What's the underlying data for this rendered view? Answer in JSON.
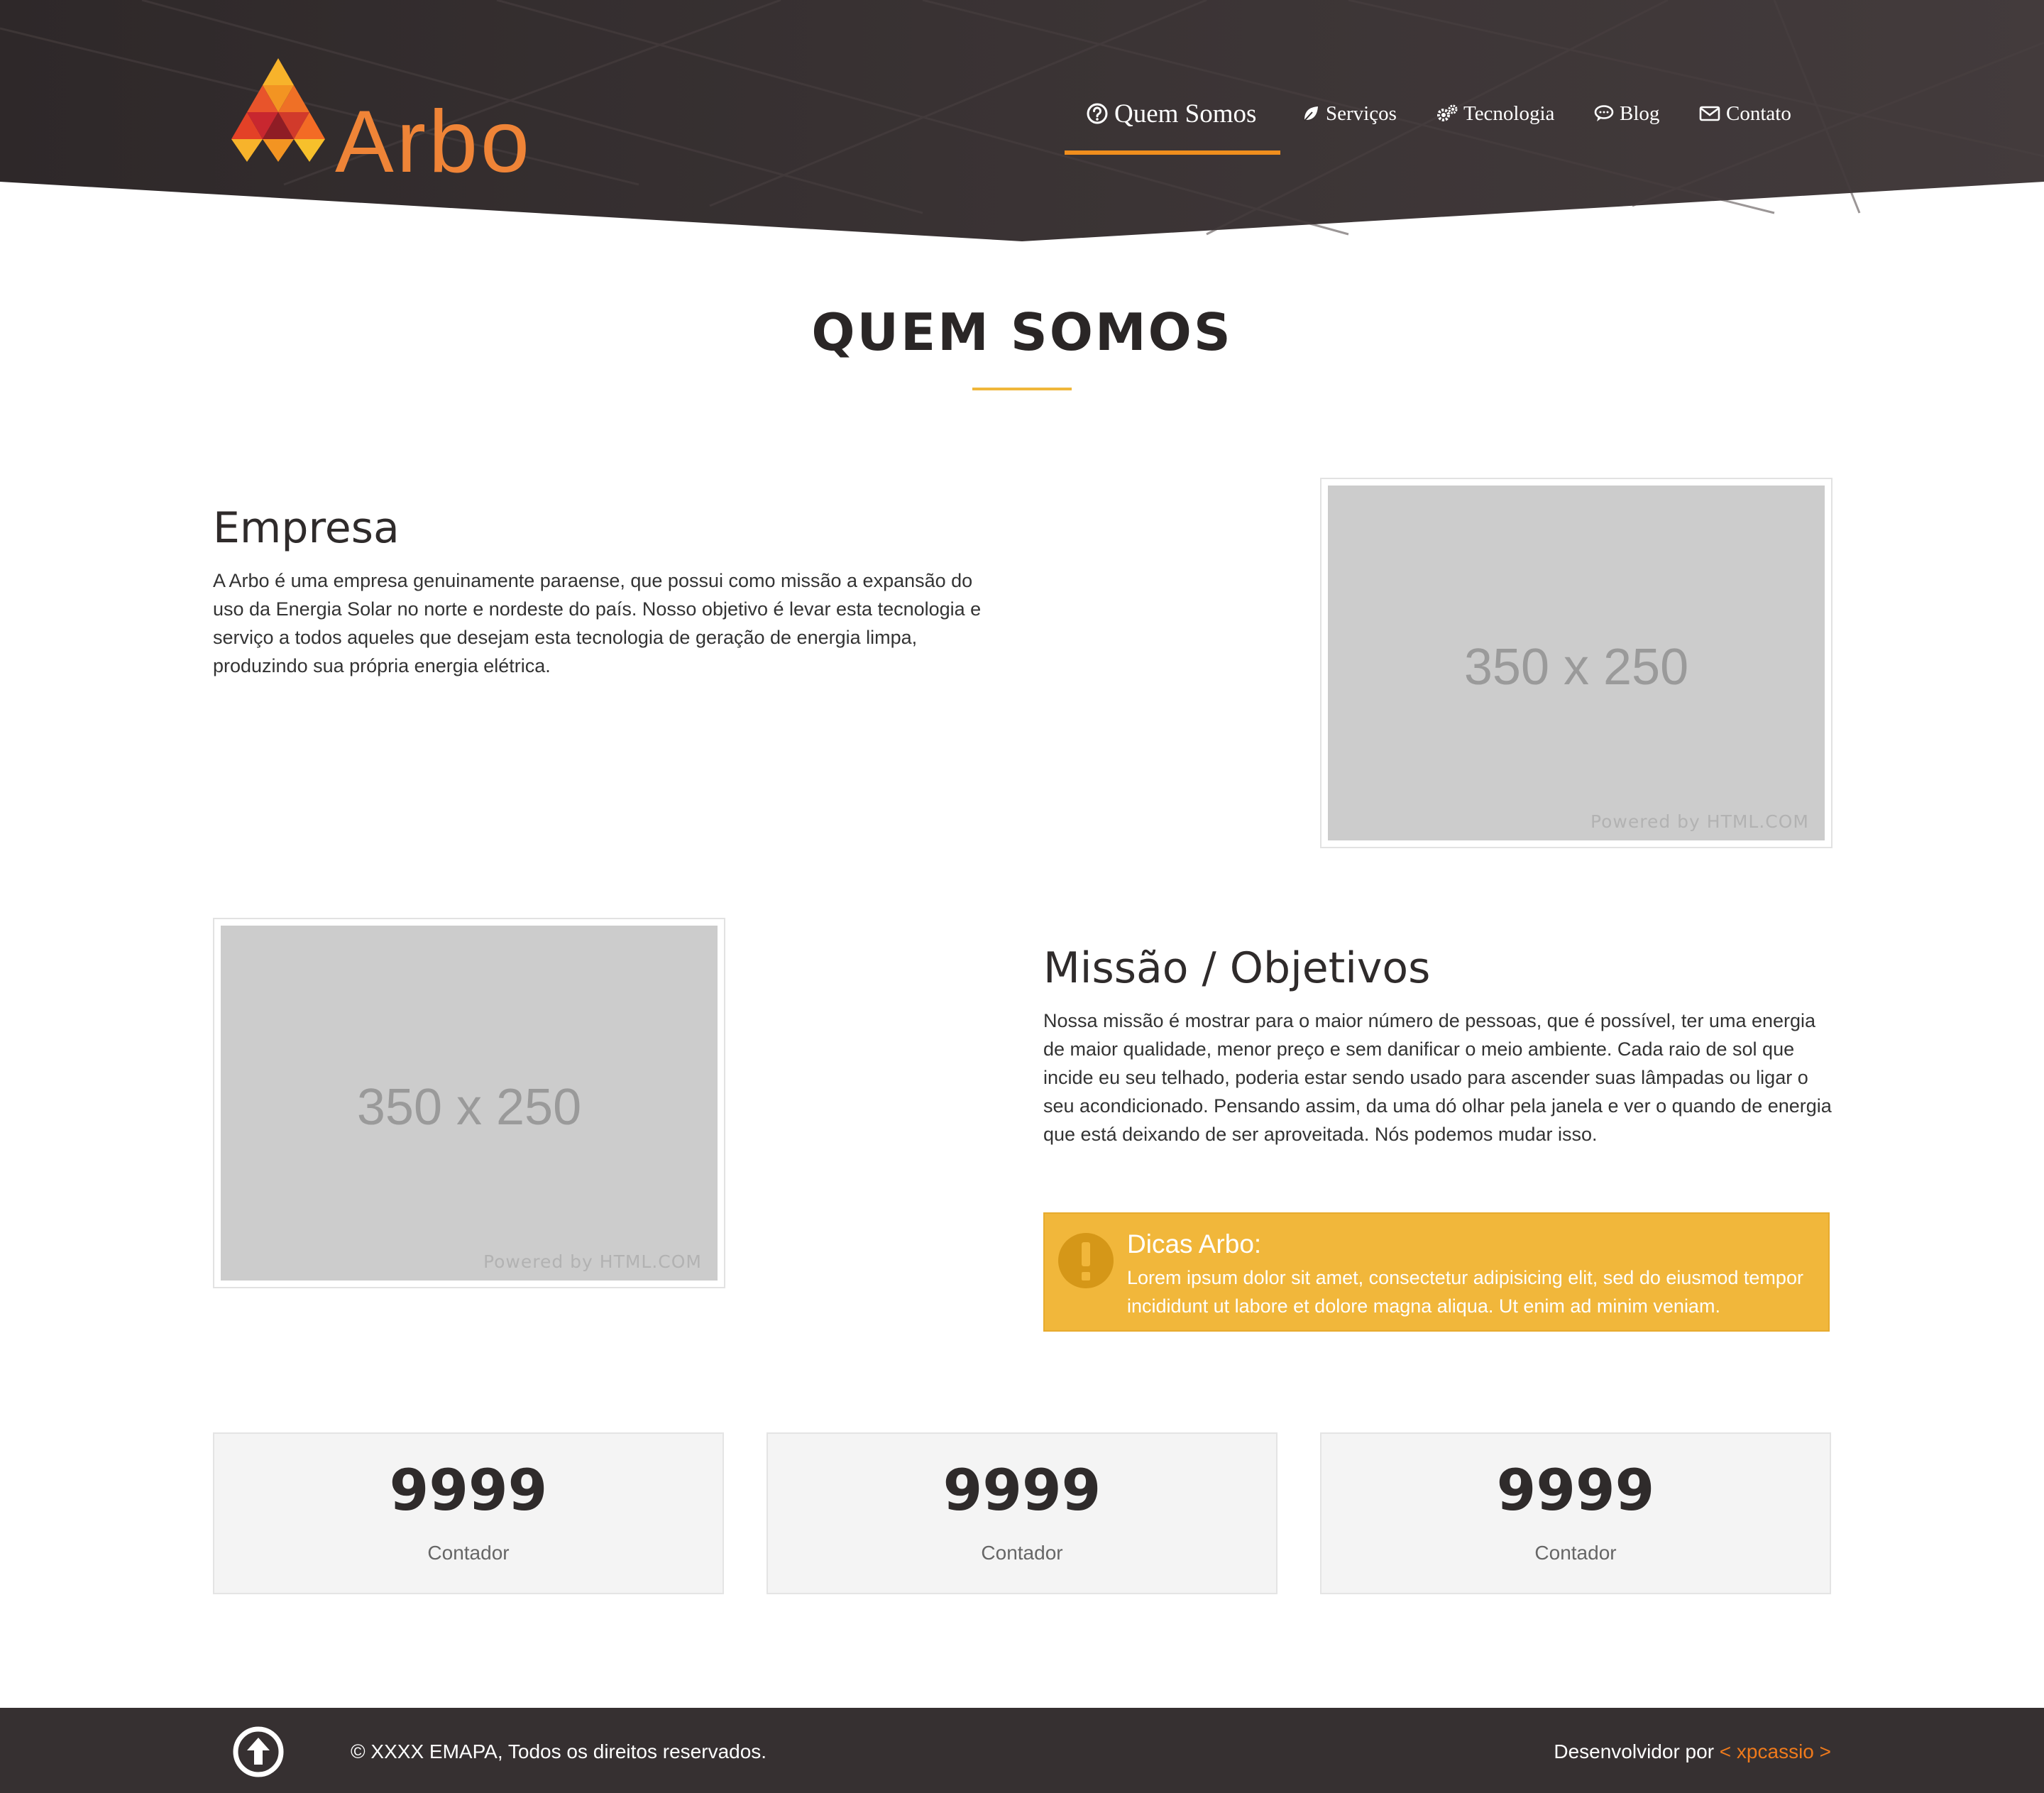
{
  "brand": {
    "name": "Arbo"
  },
  "nav": {
    "items": [
      {
        "label": "Quem Somos",
        "icon": "question-circle-icon",
        "active": true
      },
      {
        "label": "Serviços",
        "icon": "leaf-icon",
        "active": false
      },
      {
        "label": "Tecnologia",
        "icon": "gears-icon",
        "active": false
      },
      {
        "label": "Blog",
        "icon": "comment-icon",
        "active": false
      },
      {
        "label": "Contato",
        "icon": "envelope-icon",
        "active": false
      }
    ]
  },
  "section": {
    "title": "QUEM SOMOS"
  },
  "empresa": {
    "title": "Empresa",
    "text": "A Arbo é uma empresa genuinamente paraense, que possui como missão a expansão do uso da Energia Solar no norte e nordeste do país. Nosso objetivo é levar esta tecnologia e serviço a todos aqueles que desejam esta tecnologia de geração de energia limpa, produzindo sua própria energia elétrica.",
    "image": {
      "size_text": "350 x 250",
      "credit": "Powered by HTML.COM"
    }
  },
  "missao": {
    "title": "Missão / Objetivos",
    "text": "Nossa missão é mostrar para o maior número de pessoas, que é possível, ter uma energia de maior qualidade, menor preço e sem danificar o meio ambiente. Cada raio de sol que incide eu seu telhado, poderia estar sendo usado para ascender suas lâmpadas ou ligar o seu acondicionado. Pensando assim, da uma dó olhar pela janela e ver o quando de energia que está deixando de ser aproveitada. Nós podemos mudar isso.",
    "image": {
      "size_text": "350 x 250",
      "credit": "Powered by HTML.COM"
    }
  },
  "tip": {
    "title": "Dicas Arbo:",
    "text": "Lorem ipsum dolor sit amet, consectetur adipisicing elit, sed do eiusmod tempor incididunt ut labore et dolore magna aliqua. Ut enim ad minim veniam."
  },
  "counters": [
    {
      "value": "9999",
      "label": "Contador"
    },
    {
      "value": "9999",
      "label": "Contador"
    },
    {
      "value": "9999",
      "label": "Contador"
    }
  ],
  "footer": {
    "copyright": "© XXXX EMAPA, Todos os direitos reservados.",
    "dev_prefix": "Desenvolvidor por",
    "dev_link": "< xpcassio >"
  },
  "colors": {
    "header_bg": "#332d2e",
    "accent_orange": "#ef8437",
    "nav_underline": "#f08e1d",
    "alert_yellow": "#f1b73b",
    "footer_bg": "#363031",
    "dev_link": "#ef7a1c"
  }
}
